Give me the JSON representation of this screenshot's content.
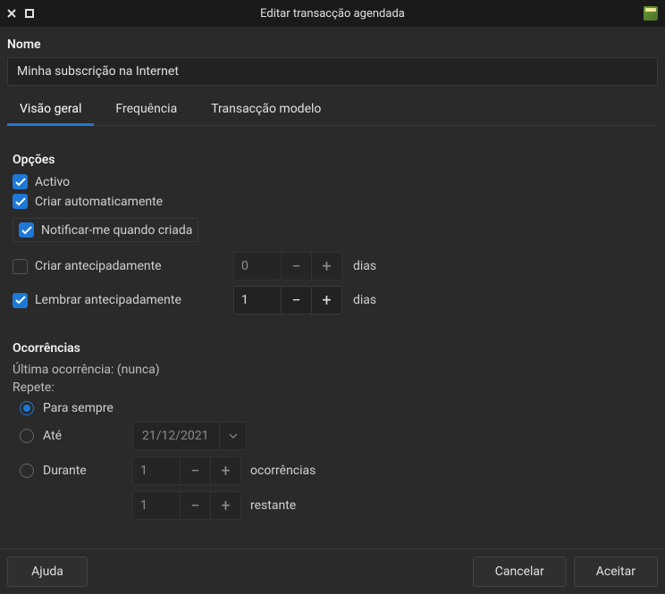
{
  "window": {
    "title": "Editar transacção agendada"
  },
  "name": {
    "label": "Nome",
    "value": "Minha subscrição na Internet"
  },
  "tabs": {
    "overview": "Visão geral",
    "frequency": "Frequência",
    "template": "Transacção modelo"
  },
  "options": {
    "title": "Opções",
    "active": "Activo",
    "auto_create": "Criar automaticamente",
    "notify_created": "Notificar-me quando criada",
    "create_advance": "Criar antecipadamente",
    "create_advance_value": "0",
    "remind_advance": "Lembrar antecipadamente",
    "remind_advance_value": "1",
    "days_label": "dias"
  },
  "occurrences": {
    "title": "Ocorrências",
    "last": "Última ocorrência: (nunca)",
    "repeats": "Repete:",
    "forever": "Para sempre",
    "until": "Até",
    "until_date": "21/12/2021",
    "for": "Durante",
    "for_value": "1",
    "for_label": "ocorrências",
    "remaining_value": "1",
    "remaining_label": "restante"
  },
  "footer": {
    "help": "Ajuda",
    "cancel": "Cancelar",
    "ok": "Aceitar"
  }
}
